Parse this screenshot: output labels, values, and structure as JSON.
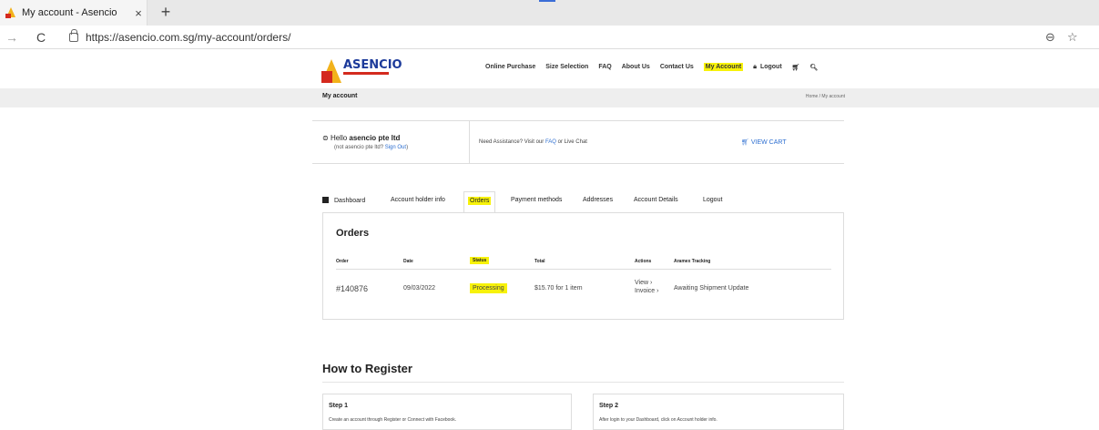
{
  "browser": {
    "tab_title": "My account - Asencio",
    "tab_close": "×",
    "new_tab": "+",
    "url": "https://asencio.com.sg/my-account/orders/"
  },
  "site": {
    "brand": "ASENCIO",
    "nav": [
      "Online Purchase",
      "Size Selection",
      "FAQ",
      "About Us",
      "Contact Us",
      "My Account",
      "Logout"
    ],
    "nav_active": "My Account",
    "page_title": "My account",
    "breadcrumb": "Home / My account"
  },
  "hello": {
    "greeting": "Hello ",
    "user": "asencio pte ltd",
    "sub_prefix": "(not asencio pte ltd? ",
    "signout": "Sign Out",
    "sub_suffix": ")",
    "assist_prefix": "Need Assistance? Visit our ",
    "faq": "FAQ",
    "assist_suffix": " or Live Chat",
    "view_cart": "VIEW CART"
  },
  "account_tabs": [
    "Dashboard",
    "Account holder info",
    "Orders",
    "Payment methods",
    "Addresses",
    "Account Details",
    "Logout"
  ],
  "orders": {
    "title": "Orders",
    "headers": [
      "Order",
      "Date",
      "Status",
      "Total",
      "Actions",
      "Aramex Tracking"
    ],
    "row": {
      "order": "#140876",
      "date": "09/03/2022",
      "status": "Processing",
      "total": "$15.70 for 1 item",
      "action_view": "View ›",
      "action_invoice": "Invoice ›",
      "tracking": "Awaiting Shipment Update"
    }
  },
  "register": {
    "title": "How to Register",
    "step1_title": "Step 1",
    "step1_text": "Create an account through Register or Connect with Facebook.",
    "step2_title": "Step 2",
    "step2_text": "After login to your Dashboard, click on Account holder info."
  },
  "colors": {
    "highlight": "#f7f20a",
    "link": "#2e6fd1"
  }
}
